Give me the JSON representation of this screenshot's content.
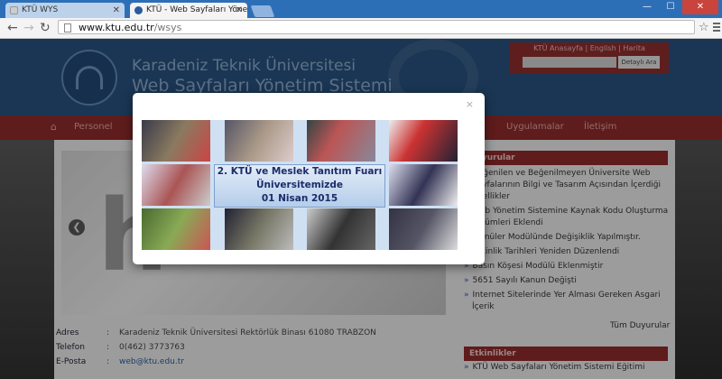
{
  "browser": {
    "tabs": [
      {
        "title": "KTÜ WYS"
      },
      {
        "title": "KTÜ - Web Sayfaları Yöne"
      }
    ],
    "url_host": "www.ktu.edu.tr",
    "url_path": "/wsys"
  },
  "site": {
    "name_line1": "Karadeniz Teknik Üniversitesi",
    "name_line2": "Web Sayfaları Yönetim Sistemi",
    "top_links": "KTÜ Anasayfa | English | Harita",
    "search_button": "Detaylı Ara",
    "nav": [
      {
        "label": "Personel"
      },
      {
        "label": "Uygulamalar"
      },
      {
        "label": "İletişim"
      }
    ],
    "contact": [
      {
        "label": "Adres",
        "value": "Karadeniz Teknik Üniversitesi Rektörlük Binası 61080 TRABZON"
      },
      {
        "label": "Telefon",
        "value": "0(462) 3773763"
      },
      {
        "label": "E-Posta",
        "value": "web@ktu.edu.tr"
      }
    ],
    "announcements": {
      "title": "Duyurular",
      "items": [
        "Beğenilen ve Beğenilmeyen Üniversite Web",
        "Sayfalarının Bilgi ve Tasarım Açısından İçerdiği",
        "Özellikler",
        "Web Yönetim Sistemine Kaynak Kodu Oluşturma",
        "Bölümleri Eklendi",
        "Menüler Modülünde Değişiklik Yapılmıştır.",
        "Etkinlik Tarihleri Yeniden Düzenlendi",
        "Basın Köşesi Modülü Eklenmiştir",
        "5651 Sayılı Kanun Değişti",
        "Internet Sitelerinde Yer Alması Gereken Asgari",
        "İçerik"
      ],
      "all_link": "Tüm Duyurular"
    },
    "events": {
      "title": "Etkinlikler",
      "items": [
        "KTÜ Web Sayfaları Yönetim Sistemi Eğitimi"
      ]
    }
  },
  "modal": {
    "close": "×",
    "poster_line1": "2. KTÜ ve Meslek Tanıtım Fuarı",
    "poster_line2": "Üniversitemizde",
    "poster_line3": "01 Nisan 2015"
  }
}
